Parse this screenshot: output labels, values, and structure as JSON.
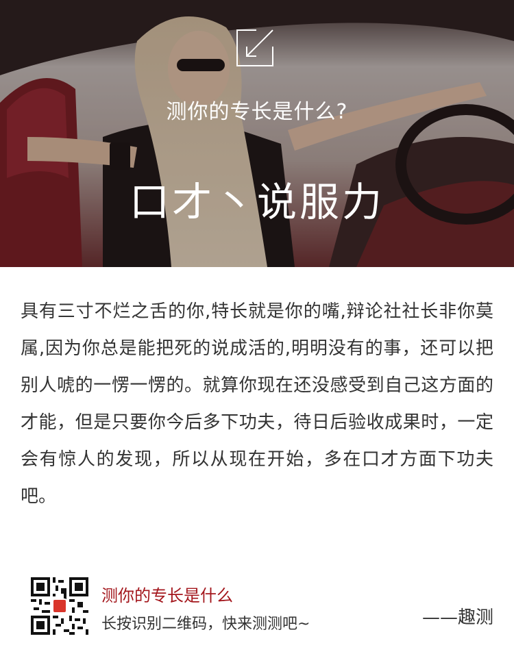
{
  "hero": {
    "subtitle": "测你的专长是什么?",
    "title": "口才丶说服力"
  },
  "description": "具有三寸不烂之舌的你,特长就是你的嘴,辩论社社长非你莫属,因为你总是能把死的说成活的,明明没有的事，还可以把别人唬的一愣一愣的。就算你现在还没感受到自己这方面的才能，但是只要你今后多下功夫，待日后验收成果时，一定会有惊人的发现，所以从现在开始，多在口才方面下功夫吧。",
  "footer": {
    "title": "测你的专长是什么",
    "subtitle": "长按识别二维码，快来测测吧~",
    "signature": "——趣测"
  },
  "colors": {
    "accent_red": "#a3161c",
    "body_text": "#333333"
  }
}
